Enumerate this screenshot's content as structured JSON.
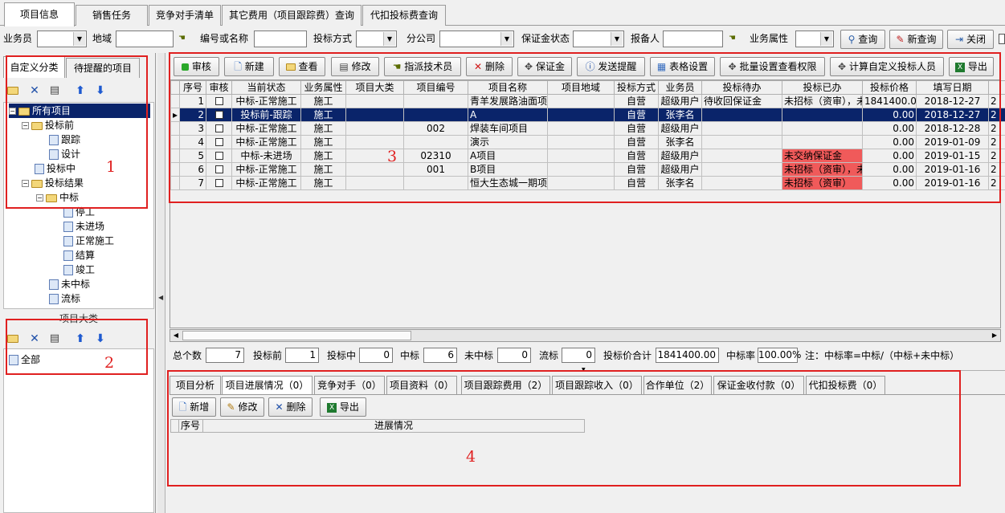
{
  "top_tabs": [
    "项目信息",
    "销售任务",
    "竞争对手清单",
    "其它费用（项目跟踪费）查询",
    "代扣投标费查询"
  ],
  "filters": {
    "salesperson": "业务员",
    "region": "地域",
    "code_or_name": "编号或名称",
    "bid_method": "投标方式",
    "branch": "分公司",
    "deposit_status": "保证金状态",
    "reporter": "报备人",
    "business_attr": "业务属性",
    "query": "查询",
    "new_query": "新查询",
    "close": "关闭"
  },
  "left_tabs": [
    "自定义分类",
    "待提醒的项目"
  ],
  "tree": {
    "root": "所有项目",
    "before_bid": "投标前",
    "track": "跟踪",
    "design": "设计",
    "in_bid": "投标中",
    "result": "投标结果",
    "won": "中标",
    "stopped": "停工",
    "not_started": "未进场",
    "normal": "正常施工",
    "settled": "结算",
    "completed": "竣工",
    "lost": "未中标",
    "failed": "流标"
  },
  "category_panel": {
    "title": "项目大类",
    "all": "全部"
  },
  "toolbar": [
    "审核",
    "新建",
    "查看",
    "修改",
    "指派技术员",
    "删除",
    "保证金",
    "发送提醒",
    "表格设置",
    "批量设置查看权限",
    "计算自定义投标人员",
    "导出"
  ],
  "columns": [
    "序号",
    "审核",
    "当前状态",
    "业务属性",
    "项目大类",
    "项目编号",
    "项目名称",
    "项目地域",
    "投标方式",
    "业务员",
    "投标待办",
    "投标已办",
    "投标价格",
    "填写日期"
  ],
  "rows": [
    [
      "1",
      "",
      "中标-正常施工",
      "施工",
      "",
      "",
      "青羊发展路油面项",
      "",
      "自营",
      "超级用户",
      "待收回保证金",
      "未招标（资审），未",
      "1841400.00",
      "2018-12-27"
    ],
    [
      "2",
      "",
      "投标前-跟踪",
      "施工",
      "",
      "",
      "A",
      "",
      "自营",
      "张李名",
      "",
      "",
      "0.00",
      "2018-12-27"
    ],
    [
      "3",
      "",
      "中标-正常施工",
      "施工",
      "",
      "002",
      "焊装车间项目",
      "",
      "自营",
      "超级用户",
      "",
      "",
      "0.00",
      "2018-12-28"
    ],
    [
      "4",
      "",
      "中标-正常施工",
      "施工",
      "",
      "",
      "演示",
      "",
      "自营",
      "张李名",
      "",
      "",
      "0.00",
      "2019-01-09"
    ],
    [
      "5",
      "",
      "中标-未进场",
      "施工",
      "",
      "02310",
      "A项目",
      "",
      "自营",
      "超级用户",
      "",
      "未交纳保证金",
      "0.00",
      "2019-01-15"
    ],
    [
      "6",
      "",
      "中标-正常施工",
      "施工",
      "",
      "001",
      "B项目",
      "",
      "自营",
      "超级用户",
      "",
      "未招标（资审），未",
      "0.00",
      "2019-01-16"
    ],
    [
      "7",
      "",
      "中标-正常施工",
      "施工",
      "",
      "",
      "恒大生态城一期项",
      "",
      "自营",
      "张李名",
      "",
      "未招标（资审）",
      "0.00",
      "2019-01-16"
    ]
  ],
  "summary": {
    "total_label": "总个数",
    "total": "7",
    "before_label": "投标前",
    "before": "1",
    "in_label": "投标中",
    "in": "0",
    "won_label": "中标",
    "won": "6",
    "lost_label": "未中标",
    "lost": "0",
    "failed_label": "流标",
    "failed": "0",
    "price_label": "投标价合计",
    "price": "1841400.00",
    "rate_label": "中标率",
    "rate": "100.00%",
    "note": "注：中标率=中标/（中标+未中标）"
  },
  "bottom_tabs": [
    "项目分析",
    "项目进展情况（0）",
    "竞争对手（0）",
    "项目资料（0）",
    "项目跟踪费用（2）",
    "项目跟踪收入（0）",
    "合作单位（2）",
    "保证金收付款（0）",
    "代扣投标费（0）"
  ],
  "bottom_toolbar": [
    "新增",
    "修改",
    "删除",
    "导出"
  ],
  "bottom_columns": [
    "序号",
    "进展情况"
  ],
  "annotations": [
    "1",
    "2",
    "3",
    "4"
  ],
  "colors": {
    "selected_row": "#0a246a",
    "alert_cell": "#f05a5a",
    "annotation": "#e02020"
  }
}
